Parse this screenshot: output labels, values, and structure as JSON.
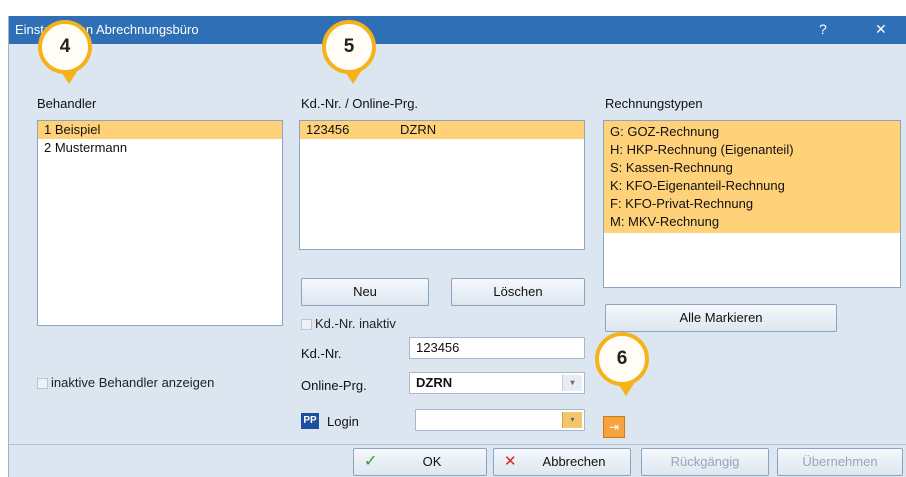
{
  "window": {
    "title": "Einstellungen Abrechnungsbüro",
    "help": "?",
    "close": "✕"
  },
  "behandler": {
    "label": "Behandler",
    "items": [
      {
        "text": "1 Beispiel",
        "selected": true
      },
      {
        "text": "2 Mustermann",
        "selected": false
      }
    ],
    "show_inactive_label": "inaktive Behandler anzeigen"
  },
  "kdnr": {
    "label": "Kd.-Nr. / Online-Prg.",
    "rows": [
      {
        "nr": "123456",
        "prg": "DZRN",
        "selected": true
      }
    ],
    "new_button": "Neu",
    "delete_button": "Löschen",
    "inactive_label": "Kd.-Nr. inaktiv",
    "kdnr_label": "Kd.-Nr.",
    "kdnr_value": "123456",
    "online_label": "Online-Prg.",
    "online_value": "DZRN",
    "login_label": "Login",
    "login_badge": "PP",
    "login_value": ""
  },
  "rechnungstypen": {
    "label": "Rechnungstypen",
    "items": [
      {
        "text": "G:  GOZ-Rechnung",
        "selected": true
      },
      {
        "text": "H:  HKP-Rechnung (Eigenanteil)",
        "selected": true
      },
      {
        "text": "S:  Kassen-Rechnung",
        "selected": true
      },
      {
        "text": "K:  KFO-Eigenanteil-Rechnung",
        "selected": true
      },
      {
        "text": "F:  KFO-Privat-Rechnung",
        "selected": true
      },
      {
        "text": "M:  MKV-Rechnung",
        "selected": true
      }
    ],
    "mark_all_button": "Alle Markieren"
  },
  "footer": {
    "ok": "OK",
    "cancel": "Abbrechen",
    "undo": "Rückgängig",
    "apply": "Übernehmen"
  },
  "callouts": {
    "c4": "4",
    "c5": "5",
    "c6": "6"
  },
  "colors": {
    "titlebar": "#2f6fb6",
    "selection": "#ffd27a",
    "callout_ring": "#f5b21b"
  }
}
